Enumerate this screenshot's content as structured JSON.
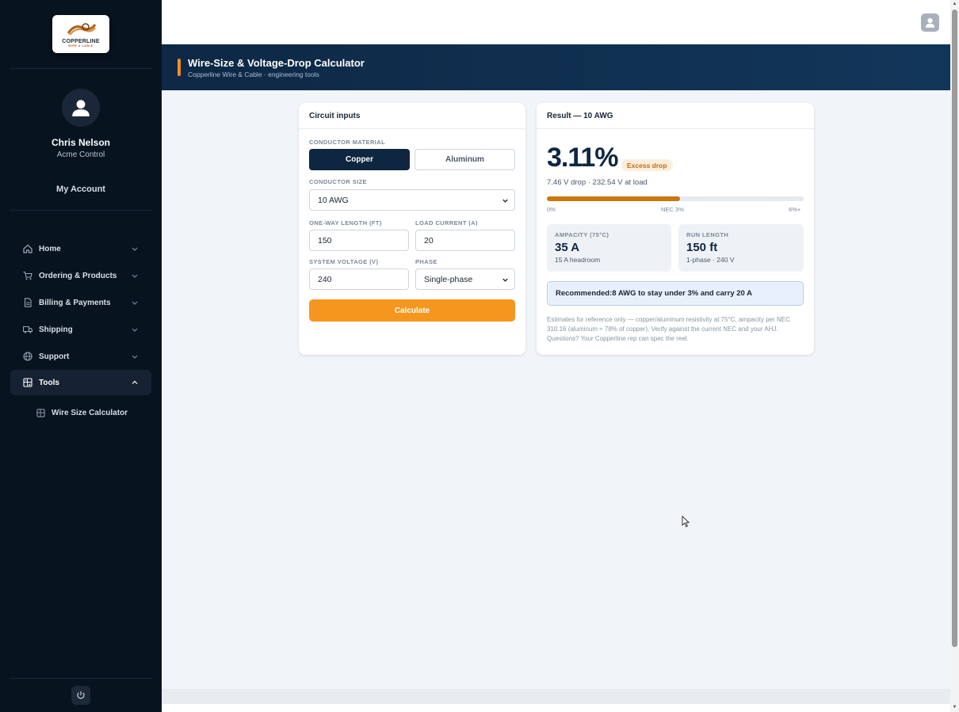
{
  "brand": {
    "logo_text": "COPPERLINE",
    "logo_sub": "WIRE & CABLE"
  },
  "user": {
    "name": "Chris Nelson",
    "org": "Acme Control",
    "account_link": "My Account"
  },
  "nav": {
    "items": [
      {
        "label": "Home",
        "icon": "home-icon",
        "expanded": false
      },
      {
        "label": "Ordering & Products",
        "icon": "cart-icon",
        "expanded": false
      },
      {
        "label": "Billing & Payments",
        "icon": "document-icon",
        "expanded": false
      },
      {
        "label": "Shipping",
        "icon": "truck-icon",
        "expanded": false
      },
      {
        "label": "Support",
        "icon": "globe-icon",
        "expanded": false
      },
      {
        "label": "Tools",
        "icon": "calculator-icon",
        "expanded": true
      }
    ],
    "sub_items": [
      {
        "label": "Wire Size Calculator",
        "icon": "calculator-icon"
      }
    ]
  },
  "header": {
    "title": "Wire-Size & Voltage-Drop Calculator",
    "subtitle": "Copperline Wire & Cable · engineering tools"
  },
  "inputs": {
    "card_title": "Circuit inputs",
    "material_label": "CONDUCTOR MATERIAL",
    "material_options": [
      "Copper",
      "Aluminum"
    ],
    "material_selected": "Copper",
    "size_label": "CONDUCTOR SIZE",
    "size_value": "10 AWG",
    "length_label": "ONE-WAY LENGTH (FT)",
    "length_value": "150",
    "current_label": "LOAD CURRENT (A)",
    "current_value": "20",
    "voltage_label": "SYSTEM VOLTAGE (V)",
    "voltage_value": "240",
    "phase_label": "PHASE",
    "phase_value": "Single-phase",
    "calculate_label": "Calculate"
  },
  "result": {
    "card_title": "Result — 10 AWG",
    "drop_percent": "3.11%",
    "badge": "Excess drop",
    "drop_detail": "7.46 V drop · 232.54 V at load",
    "bar_fraction": 0.518,
    "ticks": [
      "0%",
      "NEC 3%",
      "6%+"
    ],
    "ampacity": {
      "label": "AMPACITY (75°C)",
      "value": "35 A",
      "sub": "15 A headroom"
    },
    "run_length": {
      "label": "RUN LENGTH",
      "value": "150 ft",
      "sub": "1-phase · 240 V"
    },
    "recommendation": {
      "prefix": "Recommended: ",
      "size": "8 AWG",
      "suffix": " to stay under 3% and carry 20 A"
    },
    "note": "Estimates for reference only — copper/aluminum resistivity at 75°C, ampacity per NEC 310.16 (aluminum ≈ 78% of copper). Verify against the current NEC and your AHJ. Questions? Your Copperline rep can spec the reel."
  },
  "colors": {
    "sidebar": "#081320",
    "navy": "#0f2640",
    "accent": "#f5961f",
    "warning": "#c8780f"
  }
}
